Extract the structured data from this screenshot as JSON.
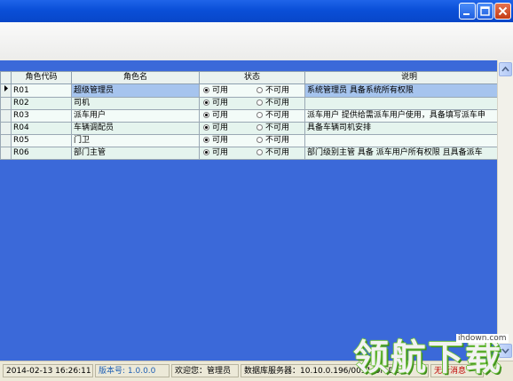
{
  "grid": {
    "headers": [
      "角色代码",
      "角色名",
      "状态",
      "说明"
    ],
    "rows": [
      {
        "code": "R01",
        "name": "超级管理员",
        "enabled": true,
        "desc": "系统管理员 具备系统所有权限"
      },
      {
        "code": "R02",
        "name": "司机",
        "enabled": true,
        "desc": ""
      },
      {
        "code": "R03",
        "name": "派车用户",
        "enabled": true,
        "desc": "派车用户 提供给需派车用户使用，具备填写派车申"
      },
      {
        "code": "R04",
        "name": "车辆调配员",
        "enabled": true,
        "desc": "具备车辆司机安排"
      },
      {
        "code": "R05",
        "name": "门卫",
        "enabled": true,
        "desc": ""
      },
      {
        "code": "R06",
        "name": "部门主管",
        "enabled": true,
        "desc": "部门级别主管 具备 派车用户所有权限 且具备派车"
      }
    ],
    "options": {
      "on": "可用",
      "off": "不可用"
    }
  },
  "status": {
    "datetime": "2014-02-13 16:26:11",
    "version": "版本号: 1.0.0.0",
    "welcome": "欢迎您：管理员",
    "server": "数据库服务器：10.10.0.196/0051/OraDb",
    "msg": "无新消息"
  },
  "watermark": {
    "text": "领航下载",
    "url": "ihdown.com"
  },
  "colors": {
    "titlebar": "#0a4fd8",
    "workarea": "#3b69d9",
    "selected": "#a6c4ee"
  }
}
